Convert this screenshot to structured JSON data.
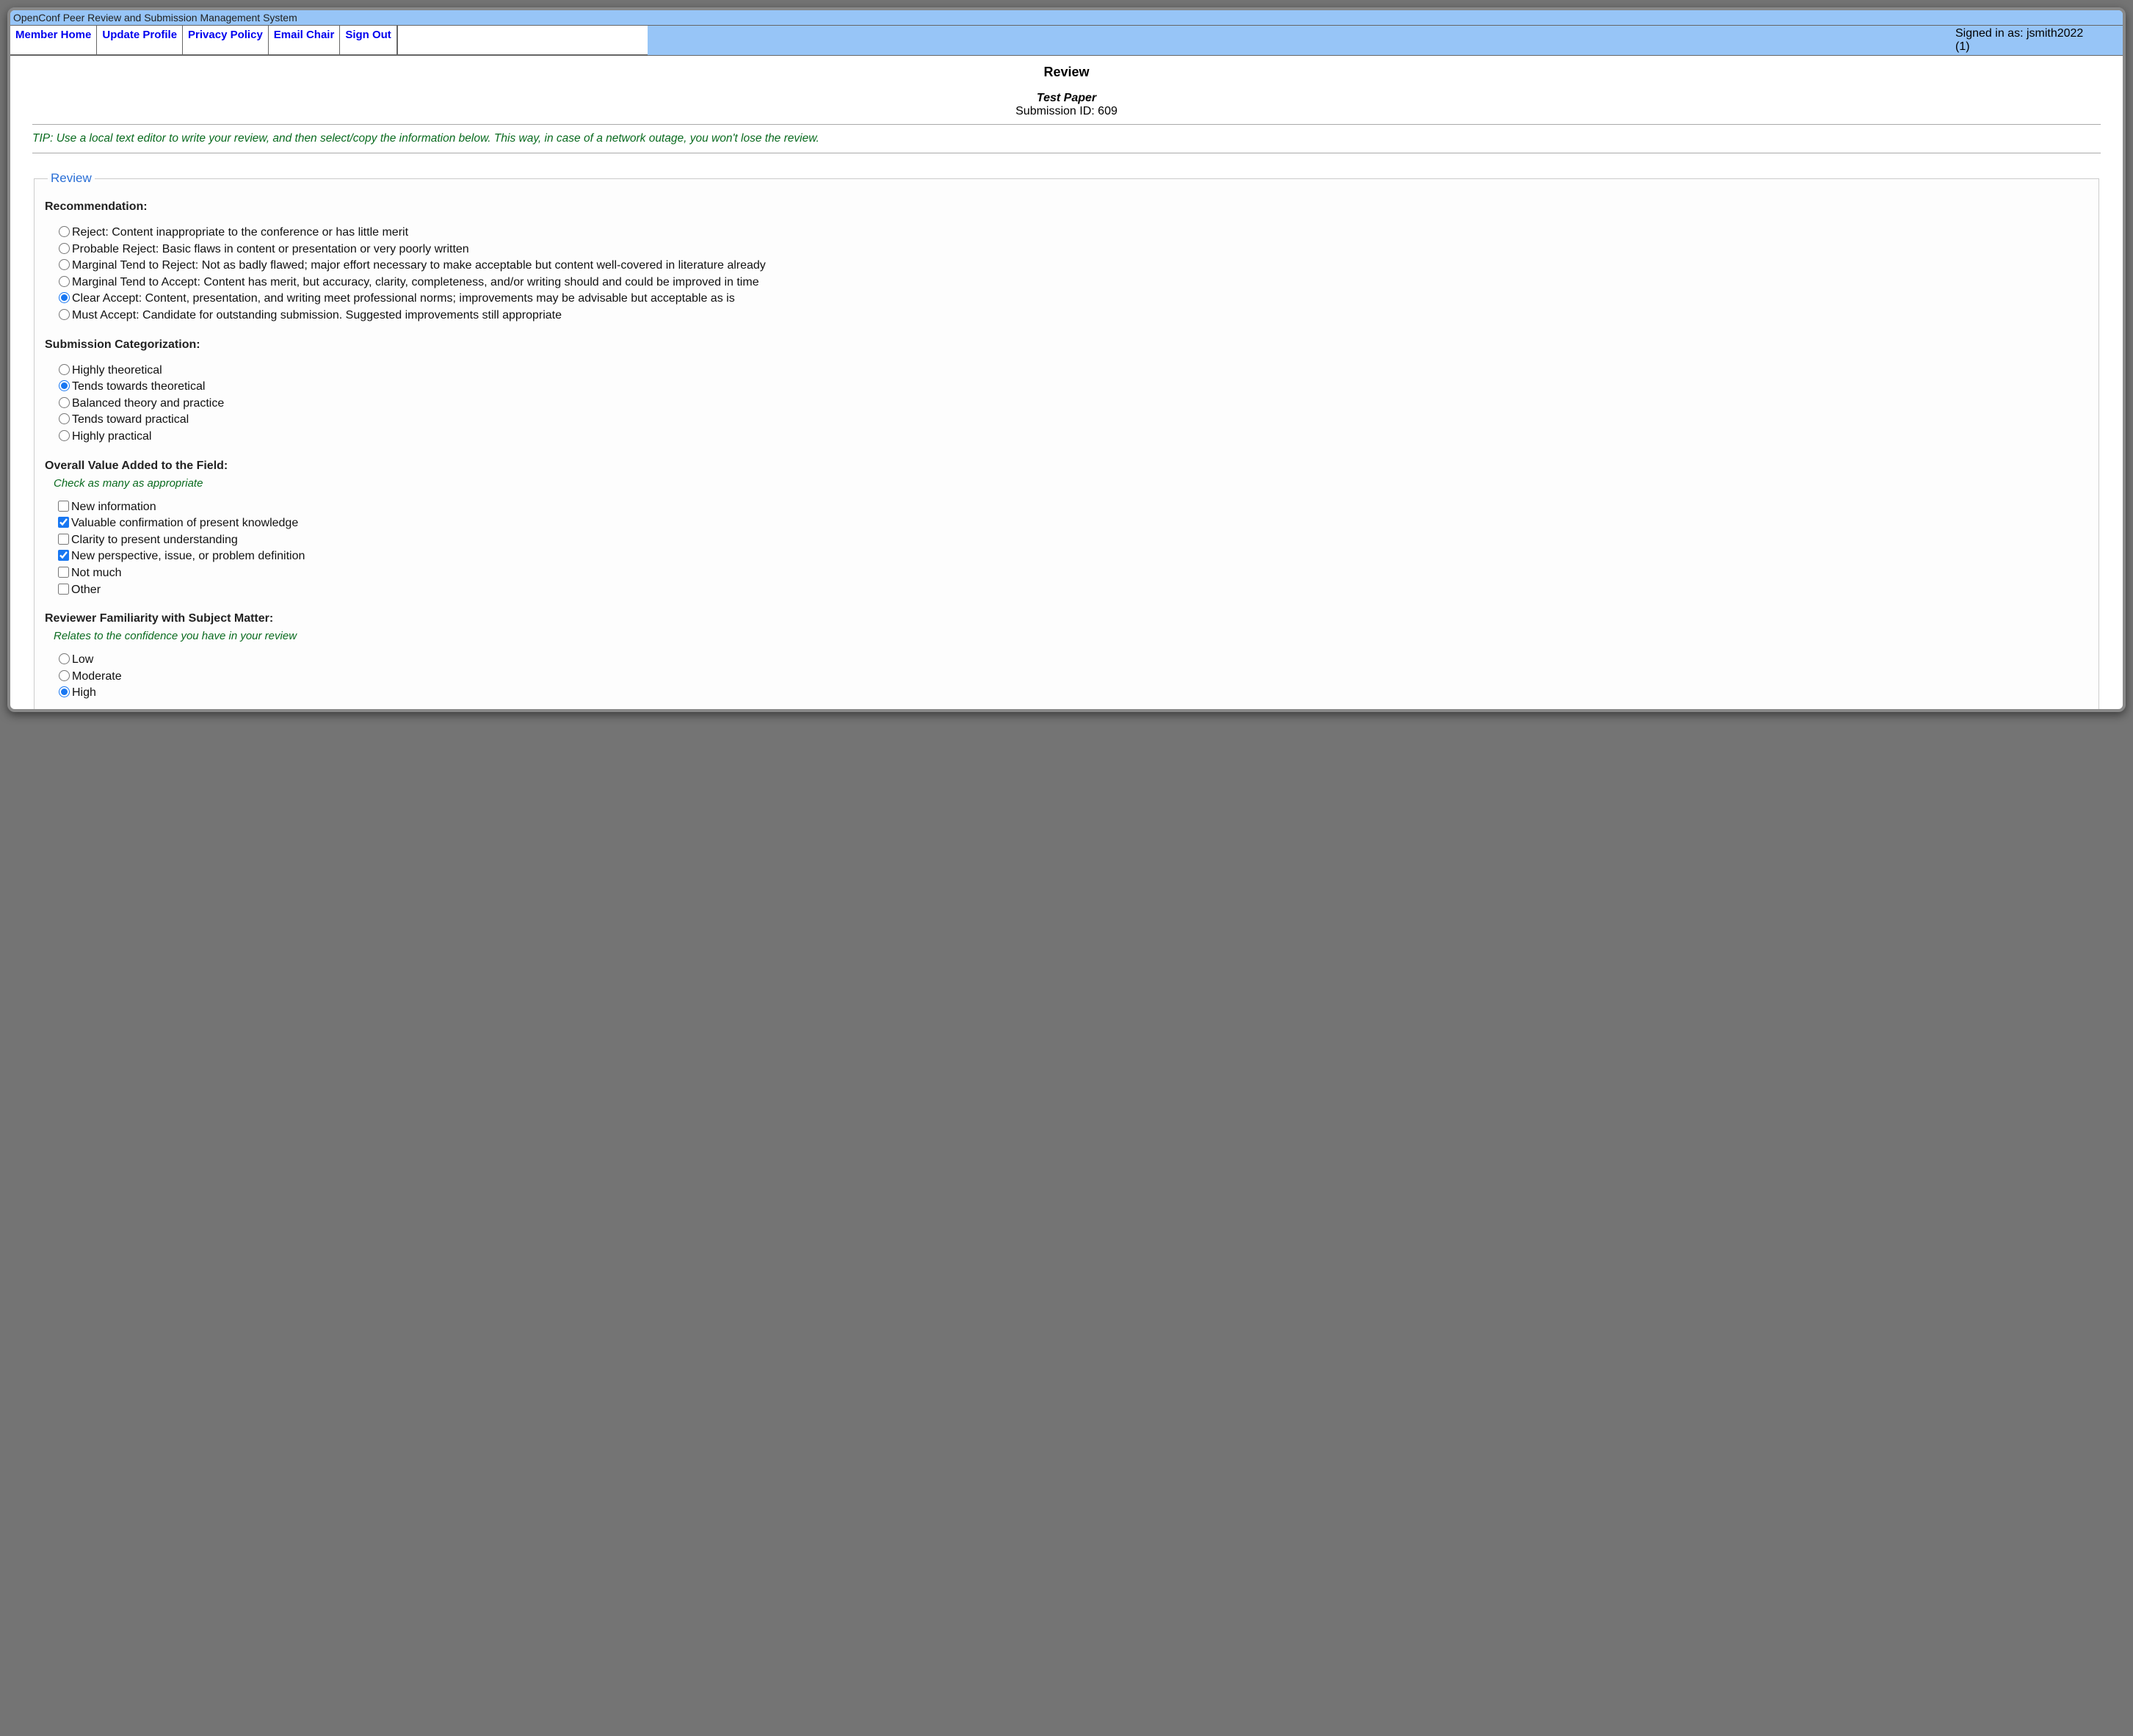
{
  "app_title": "OpenConf Peer Review and Submission Management System",
  "nav": {
    "member_home": "Member Home",
    "update_profile": "Update Profile",
    "privacy_policy": "Privacy Policy",
    "email_chair": "Email Chair",
    "sign_out": "Sign Out"
  },
  "session": {
    "signed_in_as_label": "Signed in as: ",
    "username": "jsmith2022",
    "count_label": "(1)"
  },
  "page": {
    "heading": "Review",
    "paper_title": "Test Paper",
    "submission_id_label": "Submission ID: ",
    "submission_id": "609",
    "tip": "TIP: Use a local text editor to write your review, and then select/copy the information below. This way, in case of a network outage, you won't lose the review."
  },
  "fieldset_legend": "Review",
  "recommendation": {
    "label": "Recommendation:",
    "selected_index": 4,
    "options": [
      "Reject: Content inappropriate to the conference or has little merit",
      "Probable Reject: Basic flaws in content or presentation or very poorly written",
      "Marginal Tend to Reject: Not as badly flawed; major effort necessary to make acceptable but content well-covered in literature already",
      "Marginal Tend to Accept: Content has merit, but accuracy, clarity, completeness, and/or writing should and could be improved in time",
      "Clear Accept: Content, presentation, and writing meet professional norms; improvements may be advisable but acceptable as is",
      "Must Accept: Candidate for outstanding submission. Suggested improvements still appropriate"
    ]
  },
  "categorization": {
    "label": "Submission Categorization:",
    "selected_index": 1,
    "options": [
      "Highly theoretical",
      "Tends towards theoretical",
      "Balanced theory and practice",
      "Tends toward practical",
      "Highly practical"
    ]
  },
  "value_added": {
    "label": "Overall Value Added to the Field:",
    "hint": "Check as many as appropriate",
    "checked_indices": [
      1,
      3
    ],
    "options": [
      "New information",
      "Valuable confirmation of present knowledge",
      "Clarity to present understanding",
      "New perspective, issue, or problem definition",
      "Not much",
      "Other"
    ]
  },
  "familiarity": {
    "label": "Reviewer Familiarity with Subject Matter:",
    "hint": "Relates to the confidence you have in your review",
    "selected_index": 2,
    "options": [
      "Low",
      "Moderate",
      "High"
    ]
  }
}
